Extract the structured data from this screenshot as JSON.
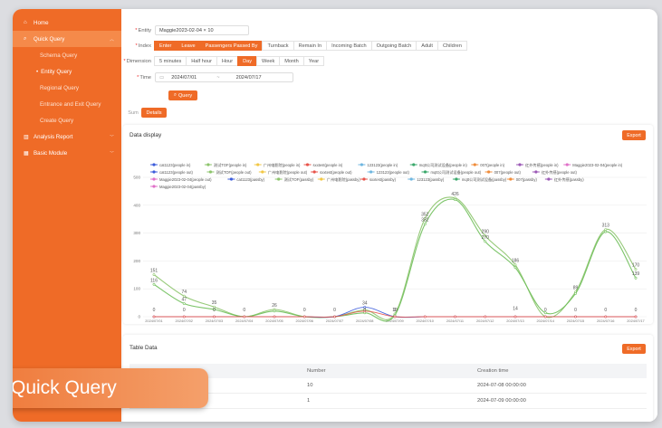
{
  "sidebar": {
    "items": [
      {
        "label": "Home",
        "icon": "home-icon"
      },
      {
        "label": "Quick Query",
        "icon": "search-icon"
      },
      {
        "label": "Schema Query"
      },
      {
        "label": "Entity Query"
      },
      {
        "label": "Regional Query"
      },
      {
        "label": "Entrance and Exit Query"
      },
      {
        "label": "Create Query"
      },
      {
        "label": "Analysis Report",
        "icon": "chart-icon"
      },
      {
        "label": "Basic Module",
        "icon": "grid-icon"
      }
    ]
  },
  "form": {
    "entity_label": "Entity",
    "entity_value": "Maggie2023-02-04 × 10",
    "index_label": "Index",
    "index_options": [
      "Enter",
      "Leave",
      "Passengers Passed By",
      "Turnback",
      "Remain In",
      "Incoming Batch",
      "Outgoing Batch",
      "Adult",
      "Children"
    ],
    "index_active": [
      0,
      1,
      2
    ],
    "dimension_label": "Dimension",
    "dimension_options": [
      "5 minutes",
      "Half hour",
      "Hour",
      "Day",
      "Week",
      "Month",
      "Year"
    ],
    "dimension_active": 3,
    "time_label": "Time",
    "time_start": "2024/07/01",
    "time_sep": "~",
    "time_end": "2024/07/17",
    "query_button": "Query",
    "tab_sum": "Sum",
    "tab_details": "Details"
  },
  "data_panel": {
    "title": "Data display",
    "export": "Export"
  },
  "table_panel": {
    "title": "Table Data",
    "export": "Export",
    "headers": [
      "Number",
      "Creation time"
    ],
    "rows": [
      [
        "10",
        "2024-07-08 00:00:00"
      ],
      [
        "1",
        "2024-07-09 00:00:00"
      ]
    ]
  },
  "banner": "Quick Query",
  "colors": {
    "accent": "#ef6b27",
    "green_line": "#8cc46b",
    "blue_line": "#3b5bdb"
  },
  "chart_data": {
    "type": "line",
    "categories": [
      "2024/07/01",
      "2024/07/02",
      "2024/07/03",
      "2024/07/04",
      "2024/07/05",
      "2024/07/06",
      "2024/07/07",
      "2024/07/08",
      "2024/07/09",
      "2024/07/10",
      "2024/07/11",
      "2024/07/12",
      "2024/07/13",
      "2024/07/14",
      "2024/07/15",
      "2024/07/16",
      "2024/07/17"
    ],
    "ylim": [
      0,
      500
    ],
    "yticks": [
      0,
      100,
      200,
      300,
      400,
      500
    ],
    "legend": [
      {
        "name": "cat1123(people in)",
        "color": "#3b5bdb"
      },
      {
        "name": "测试TOF(people in)",
        "color": "#8cc46b"
      },
      {
        "name": "广州电影院(people in)",
        "color": "#f2c744"
      },
      {
        "name": "sxxtest(people in)",
        "color": "#e8534a"
      },
      {
        "name": "123123(people in)",
        "color": "#6fb7e0"
      },
      {
        "name": "mqtt公司测试设备(people in)",
        "color": "#3aa86b"
      },
      {
        "name": "007(people in)",
        "color": "#f08c3a"
      },
      {
        "name": "红外传感(people in)",
        "color": "#9b59b6"
      },
      {
        "name": "Maggie2023-02-04(people in)",
        "color": "#e070c8"
      },
      {
        "name": "cat1123(people out)",
        "color": "#3b5bdb"
      },
      {
        "name": "测试TOF(people out)",
        "color": "#8cc46b"
      },
      {
        "name": "广州电影院(people out)",
        "color": "#f2c744"
      },
      {
        "name": "sxxtest(people out)",
        "color": "#e8534a"
      },
      {
        "name": "123123(people out)",
        "color": "#6fb7e0"
      },
      {
        "name": "mqtt公司测试设备(people out)",
        "color": "#3aa86b"
      },
      {
        "name": "007(people out)",
        "color": "#f08c3a"
      },
      {
        "name": "红外传感(people out)",
        "color": "#9b59b6"
      },
      {
        "name": "Maggie2023-02-04(people out)",
        "color": "#e070c8"
      },
      {
        "name": "cat1123(passby)",
        "color": "#3b5bdb"
      },
      {
        "name": "测试TOF(passby)",
        "color": "#8cc46b"
      },
      {
        "name": "广州电影院(passby)",
        "color": "#f2c744"
      },
      {
        "name": "sxxtest(passby)",
        "color": "#e8534a"
      },
      {
        "name": "123123(passby)",
        "color": "#6fb7e0"
      },
      {
        "name": "mqtt公司测试设备(passby)",
        "color": "#3aa86b"
      },
      {
        "name": "007(passby)",
        "color": "#f08c3a"
      },
      {
        "name": "红外传感(passby)",
        "color": "#9b59b6"
      },
      {
        "name": "Maggie2023-02-04(passby)",
        "color": "#e070c8"
      }
    ],
    "series": [
      {
        "color": "#8cc46b",
        "values": [
          151,
          74,
          35,
          0,
          26,
          0,
          0,
          24,
          10,
          352,
          426,
          290,
          186,
          0,
          89,
          313,
          170
        ]
      },
      {
        "color": "#6fbf5a",
        "values": [
          116,
          47,
          26,
          0,
          20,
          0,
          0,
          14,
          5,
          332,
          420,
          270,
          176,
          14,
          83,
          305,
          139
        ]
      },
      {
        "color": "#3b5bdb",
        "values": [
          0,
          0,
          0,
          0,
          0,
          0,
          0,
          34,
          0,
          0,
          0,
          0,
          0,
          0,
          0,
          0,
          0
        ]
      },
      {
        "color": "#e8534a",
        "values": [
          0,
          0,
          0,
          0,
          0,
          0,
          0,
          20,
          0,
          0,
          0,
          0,
          0,
          0,
          0,
          0,
          0
        ]
      }
    ],
    "labels": [
      {
        "i": 0,
        "text": "151",
        "v": 151
      },
      {
        "i": 0,
        "text": "116",
        "v": 116
      },
      {
        "i": 0,
        "text": "0",
        "v": 0
      },
      {
        "i": 1,
        "text": "74",
        "v": 74
      },
      {
        "i": 1,
        "text": "47",
        "v": 47
      },
      {
        "i": 1,
        "text": "0",
        "v": 0
      },
      {
        "i": 2,
        "text": "35",
        "v": 35
      },
      {
        "i": 2,
        "text": "0",
        "v": 0
      },
      {
        "i": 3,
        "text": "0",
        "v": 0
      },
      {
        "i": 4,
        "text": "26",
        "v": 26
      },
      {
        "i": 5,
        "text": "0",
        "v": 0
      },
      {
        "i": 6,
        "text": "0",
        "v": 0
      },
      {
        "i": 7,
        "text": "34",
        "v": 34
      },
      {
        "i": 7,
        "text": "0",
        "v": 0
      },
      {
        "i": 8,
        "text": "10",
        "v": 10
      },
      {
        "i": 8,
        "text": "0",
        "v": 0
      },
      {
        "i": 9,
        "text": "352",
        "v": 352
      },
      {
        "i": 9,
        "text": "332",
        "v": 332
      },
      {
        "i": 10,
        "text": "426",
        "v": 426
      },
      {
        "i": 11,
        "text": "290",
        "v": 290
      },
      {
        "i": 11,
        "text": "270",
        "v": 270
      },
      {
        "i": 12,
        "text": "186",
        "v": 186
      },
      {
        "i": 12,
        "text": "14",
        "v": 14
      },
      {
        "i": 13,
        "text": "0",
        "v": 0
      },
      {
        "i": 14,
        "text": "89",
        "v": 89
      },
      {
        "i": 14,
        "text": "0",
        "v": 0
      },
      {
        "i": 15,
        "text": "313",
        "v": 313
      },
      {
        "i": 15,
        "text": "0",
        "v": 0
      },
      {
        "i": 16,
        "text": "170",
        "v": 170
      },
      {
        "i": 16,
        "text": "139",
        "v": 139
      },
      {
        "i": 16,
        "text": "0",
        "v": 0
      }
    ]
  }
}
